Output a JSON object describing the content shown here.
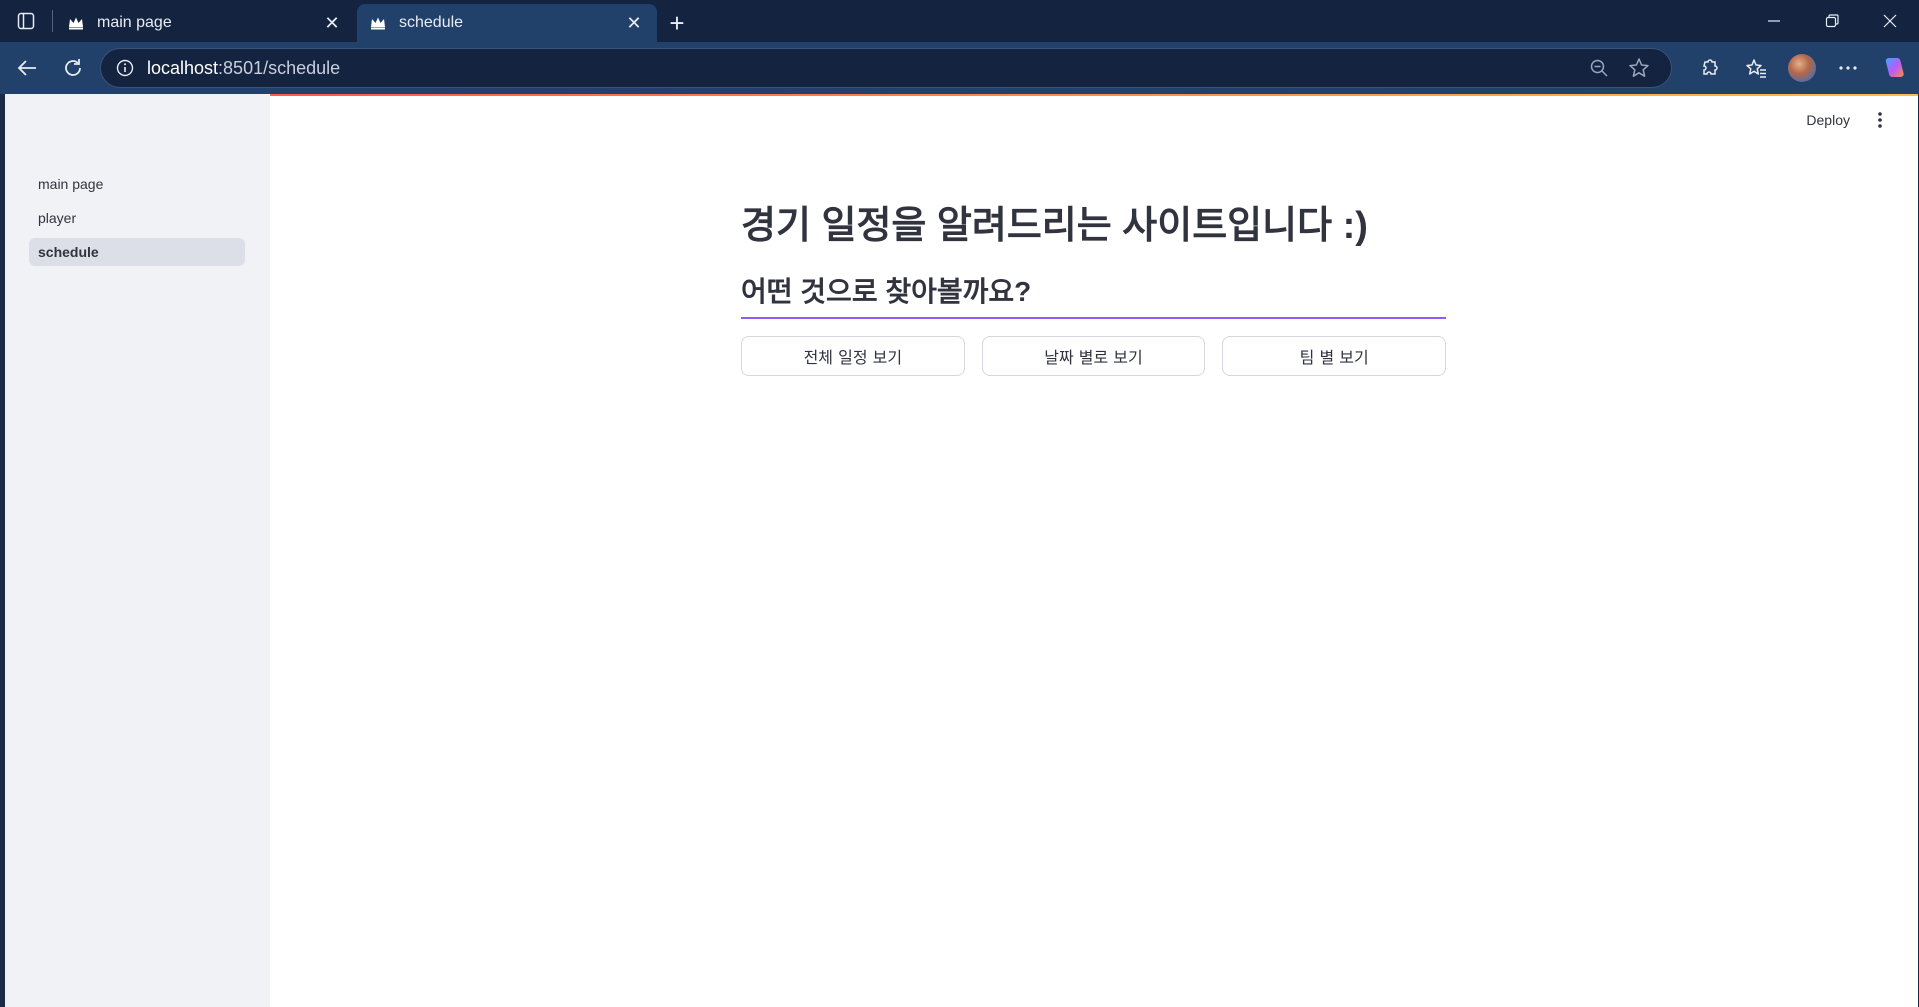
{
  "browser": {
    "tabs": [
      {
        "title": "main page",
        "active": false,
        "favicon": "crown-icon"
      },
      {
        "title": "schedule",
        "active": true,
        "favicon": "crown-icon"
      }
    ],
    "address": {
      "host": "localhost",
      "path": ":8501/schedule"
    }
  },
  "app": {
    "header": {
      "deploy_label": "Deploy"
    },
    "sidebar": {
      "items": [
        {
          "label": "main page",
          "active": false
        },
        {
          "label": "player",
          "active": false
        },
        {
          "label": "schedule",
          "active": true
        }
      ]
    },
    "main": {
      "title": "경기 일정을 알려드리는 사이트입니다 :)",
      "subtitle": "어떤 것으로 찾아볼까요?",
      "buttons": [
        {
          "label": "전체 일정 보기"
        },
        {
          "label": "날짜 별로 보기"
        },
        {
          "label": "팀 별 보기"
        }
      ]
    }
  },
  "colors": {
    "divider": "#8e5cf7",
    "sidebar_bg": "#f0f2f6",
    "text": "#31333f"
  }
}
